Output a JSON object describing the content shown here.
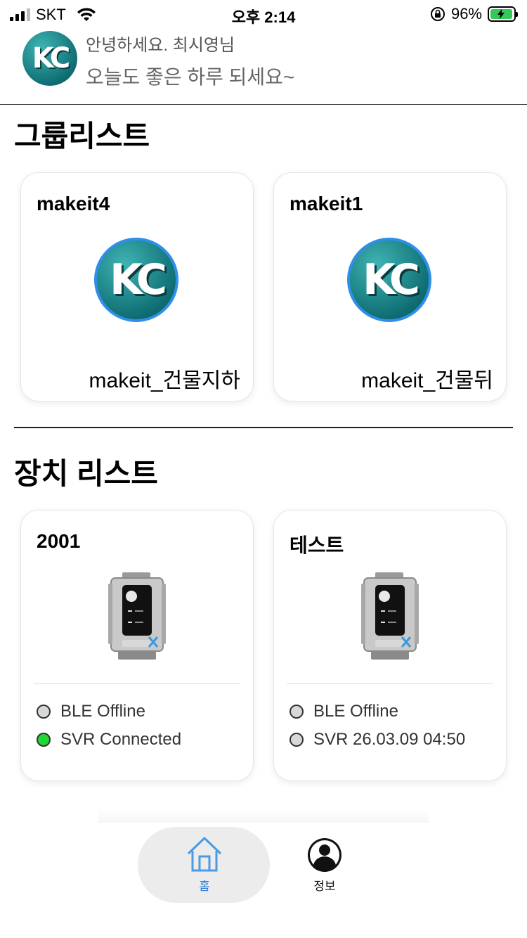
{
  "status_bar": {
    "carrier": "SKT",
    "time": "오후 2:14",
    "battery_percent": "96%",
    "battery_level": 0.96,
    "charging": true
  },
  "header": {
    "logo_text": "KC",
    "greeting": "안녕하세요. 최시영님",
    "subgreeting": "오늘도 좋은 하루 되세요~"
  },
  "groups": {
    "title": "그룹리스트",
    "items": [
      {
        "name": "makeit4",
        "logo_text": "KC",
        "location": "makeit_건물지하"
      },
      {
        "name": "makeit1",
        "logo_text": "KC",
        "location": "makeit_건물뒤"
      }
    ]
  },
  "devices": {
    "title": "장치 리스트",
    "items": [
      {
        "name": "2001",
        "ble_status": "BLE Offline",
        "ble_color": "#d8d8d8",
        "svr_status": "SVR Connected",
        "svr_color": "#22d633"
      },
      {
        "name": "테스트",
        "ble_status": "BLE Offline",
        "ble_color": "#d8d8d8",
        "svr_status": "SVR 26.03.09 04:50",
        "svr_color": "#d8d8d8"
      }
    ]
  },
  "bottom_nav": {
    "home_label": "홈",
    "info_label": "정보",
    "active_color": "#2d7fd6",
    "home_icon": "house-icon",
    "info_icon": "person-icon"
  }
}
